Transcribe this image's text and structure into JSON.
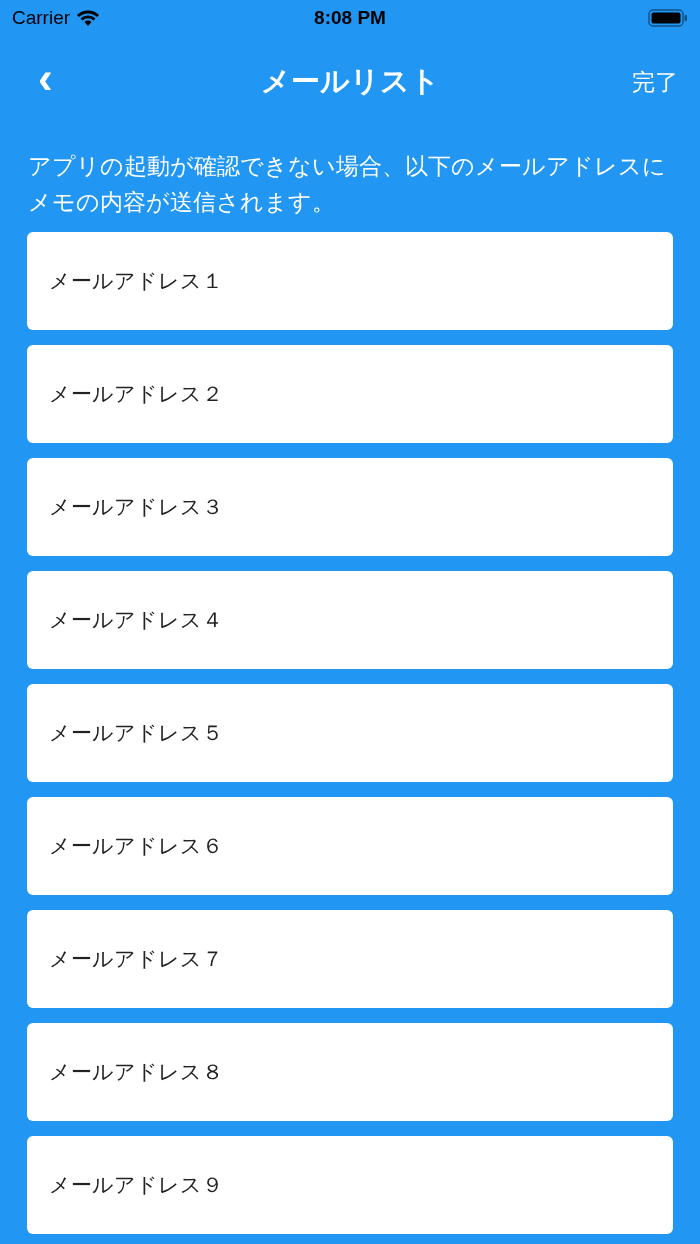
{
  "status_bar": {
    "carrier": "Carrier",
    "time": "8:08 PM"
  },
  "nav": {
    "back": "‹",
    "title": "メールリスト",
    "done": "完了"
  },
  "description": "アプリの起動が確認できない場合、以下のメールアドレスにメモの内容が送信されます。",
  "fields": [
    {
      "placeholder": "メールアドレス１"
    },
    {
      "placeholder": "メールアドレス２"
    },
    {
      "placeholder": "メールアドレス３"
    },
    {
      "placeholder": "メールアドレス４"
    },
    {
      "placeholder": "メールアドレス５"
    },
    {
      "placeholder": "メールアドレス６"
    },
    {
      "placeholder": "メールアドレス７"
    },
    {
      "placeholder": "メールアドレス８"
    },
    {
      "placeholder": "メールアドレス９"
    }
  ]
}
